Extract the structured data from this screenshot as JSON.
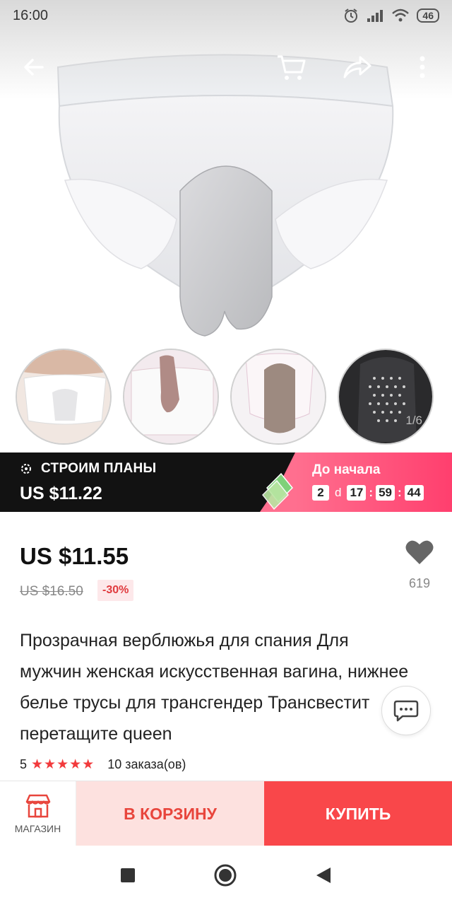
{
  "status_bar": {
    "time": "16:00",
    "battery": "46",
    "icons": [
      "alarm-icon",
      "signal-icon",
      "wifi-icon",
      "battery-icon"
    ]
  },
  "top_bar": {
    "icons": [
      "back-arrow-icon",
      "cart-icon",
      "share-icon",
      "more-vertical-icon"
    ]
  },
  "gallery": {
    "counter": "1/6",
    "thumbnails": [
      "thumbnail-1",
      "thumbnail-2",
      "thumbnail-3",
      "thumbnail-4"
    ]
  },
  "promo": {
    "tag": "СТРОИМ ПЛАНЫ",
    "price": "US $11.22",
    "starts_label": "До начала",
    "countdown": {
      "days": "2",
      "days_unit": "d",
      "hours": "17",
      "minutes": "59",
      "seconds": "44"
    },
    "colors": {
      "left_bg": "#121212",
      "right_bg": "#ff4f78"
    }
  },
  "pricing": {
    "price": "US $11.55",
    "old_price": "US $16.50",
    "discount": "-30%",
    "likes": "619"
  },
  "product": {
    "title": "Прозрачная верблюжья для спания Для мужчин женская искусственная вагина, нижнее белье трусы для трансгендер Трансвестит перетащите queen",
    "rating": "5",
    "stars": "★★★★★",
    "orders": "10 заказа(ов)"
  },
  "actions": {
    "store_label": "МАГАЗИН",
    "cart_label": "В КОРЗИНУ",
    "buy_label": "КУПИТЬ",
    "colors": {
      "cart_bg": "#fde1df",
      "buy_bg": "#f9474a",
      "accent": "#e8453c"
    }
  },
  "android_nav": [
    "recents-square-icon",
    "home-circle-icon",
    "back-triangle-icon"
  ]
}
